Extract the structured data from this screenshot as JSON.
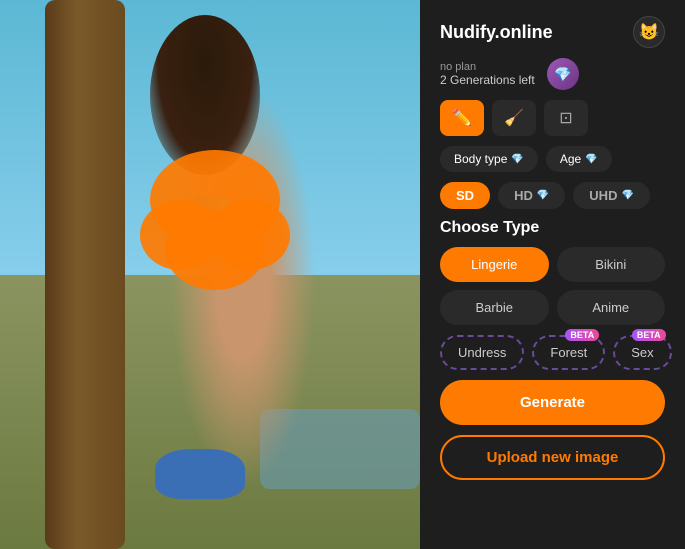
{
  "app": {
    "title": "Nudify.online",
    "avatar_icon": "😺",
    "plan_label": "no plan",
    "generations_left": "2 Generations left",
    "diamond_icon": "💎"
  },
  "tools": {
    "brush_icon": "✏️",
    "eraser_icon": "⌫",
    "crop_icon": "⊡"
  },
  "options": {
    "body_type_label": "Body type",
    "age_label": "Age"
  },
  "quality": {
    "options": [
      "SD",
      "HD",
      "UHD"
    ]
  },
  "choose_type": {
    "title": "Choose Type",
    "types": [
      {
        "label": "Lingerie",
        "active": true
      },
      {
        "label": "Bikini",
        "active": false
      },
      {
        "label": "Barbie",
        "active": false
      },
      {
        "label": "Anime",
        "active": false
      }
    ],
    "beta_types": [
      {
        "label": "Undress",
        "beta": false
      },
      {
        "label": "Forest",
        "beta": true
      },
      {
        "label": "Sex",
        "beta": true
      }
    ]
  },
  "actions": {
    "generate_label": "Generate",
    "upload_label": "Upload new image"
  }
}
